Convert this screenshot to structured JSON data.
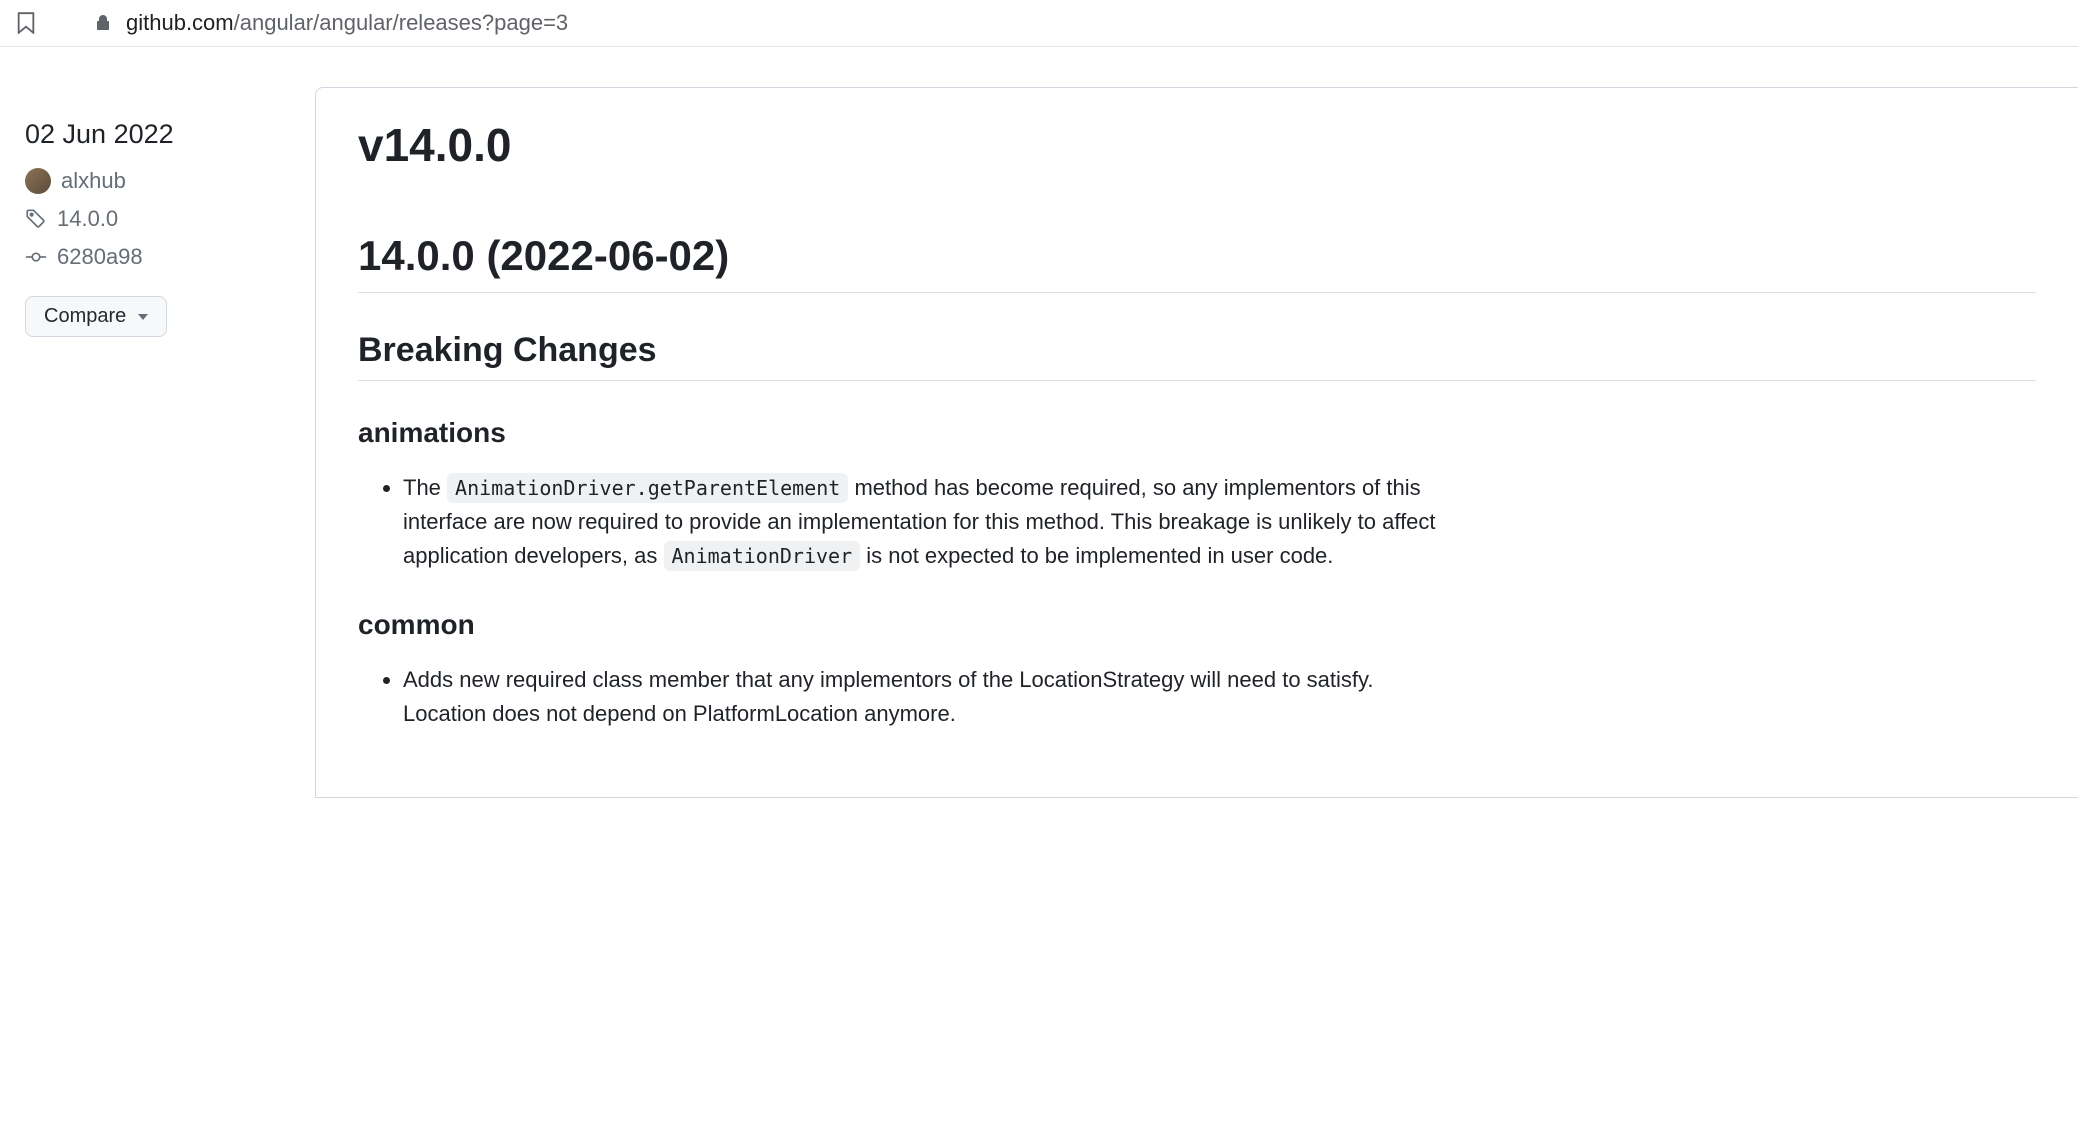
{
  "browser": {
    "url_domain": "github.com",
    "url_path": "/angular/angular/releases?page=3"
  },
  "sidebar": {
    "date": "02 Jun 2022",
    "username": "alxhub",
    "tag": "14.0.0",
    "commit": "6280a98",
    "compare_label": "Compare"
  },
  "release": {
    "title": "v14.0.0",
    "heading": "14.0.0 (2022-06-02)",
    "breaking_changes_heading": "Breaking Changes",
    "sections": {
      "animations": {
        "heading": "animations",
        "item_prefix": "The ",
        "item_code1": "AnimationDriver.getParentElement",
        "item_mid": " method has become required, so any implementors of this interface are now required to provide an implementation for this method. This breakage is unlikely to affect application developers, as ",
        "item_code2": "AnimationDriver",
        "item_suffix": " is not expected to be implemented in user code."
      },
      "common": {
        "heading": "common",
        "item1": "Adds new required class member that any implementors of the LocationStrategy will need to satisfy. Location does not depend on PlatformLocation anymore."
      }
    }
  }
}
